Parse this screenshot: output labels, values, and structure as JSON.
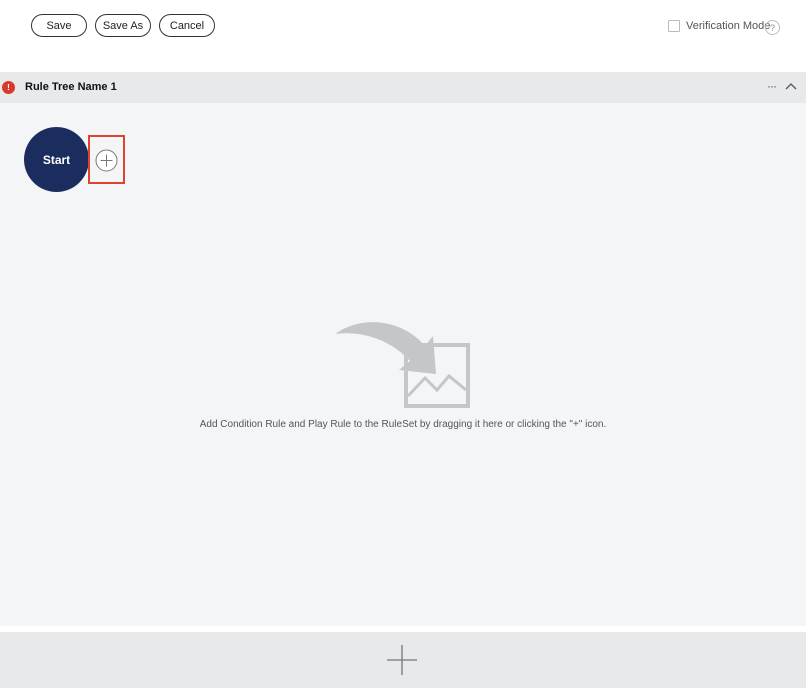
{
  "toolbar": {
    "save_label": "Save",
    "save_as_label": "Save As",
    "cancel_label": "Cancel"
  },
  "verification": {
    "label": "Verification Mode",
    "checked": false,
    "help_label": "?"
  },
  "tree": {
    "name": "Rule Tree Name 1",
    "status": "error",
    "error_mark": "!",
    "more_label": "···"
  },
  "canvas": {
    "start_label": "Start",
    "empty_message": "Add Condition Rule and Play Rule to the RuleSet by dragging it here or clicking the \"+\" icon."
  },
  "colors": {
    "start_node": "#1b2d5e",
    "error": "#d8392c",
    "highlight": "#e0432d",
    "header_bg": "#e8e9ea",
    "canvas_bg": "#f4f5f6"
  },
  "icons": {
    "add": "plus-circle-icon",
    "collapse": "chevron-up-icon",
    "more": "ellipsis-icon",
    "help": "question-icon",
    "error": "error-icon",
    "footer_add": "plus-icon",
    "empty": "drag-to-image-icon"
  }
}
